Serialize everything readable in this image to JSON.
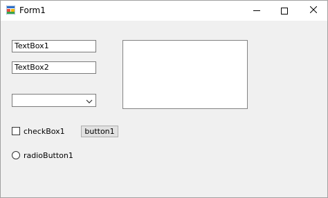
{
  "window": {
    "title": "Form1",
    "app_icon": "winforms-app-icon",
    "controls": {
      "minimize_icon": "minimize-icon",
      "maximize_icon": "maximize-icon",
      "close_icon": "close-icon"
    }
  },
  "form": {
    "textbox1": {
      "value": "TextBox1"
    },
    "textbox2": {
      "value": "TextBox2"
    },
    "combobox": {
      "value": "",
      "arrow_icon": "chevron-down-icon"
    },
    "listbox": {
      "items": []
    },
    "checkbox1": {
      "label": "checkBox1",
      "checked": false
    },
    "button1": {
      "label": "button1"
    },
    "radiobutton1": {
      "label": "radioButton1",
      "selected": false
    }
  },
  "colors": {
    "form_background": "#f0f0f0",
    "titlebar_background": "#ffffff",
    "button_background": "#e1e1e1"
  }
}
